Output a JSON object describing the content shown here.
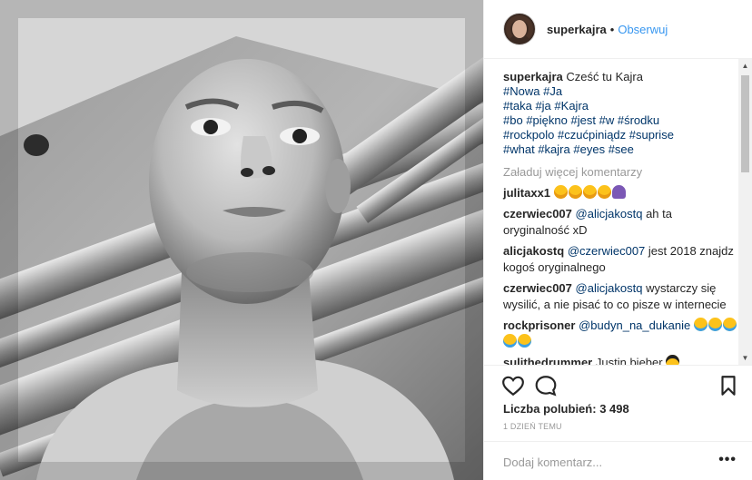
{
  "header": {
    "username": "superkajra",
    "separator": "•",
    "follow_label": "Obserwuj"
  },
  "caption": {
    "username": "superkajra",
    "text": "Cześć tu Kajra",
    "hashtag_lines": [
      [
        "#Nowa",
        "#Ja"
      ],
      [
        "#taka",
        "#ja",
        "#Kajra"
      ],
      [
        "#bo",
        "#piękno",
        "#jest",
        "#w",
        "#środku"
      ],
      [
        "#rockpolo",
        "#czućpiniądz",
        "#suprise"
      ],
      [
        "#what",
        "#kajra",
        "#eyes",
        "#see"
      ]
    ]
  },
  "load_more_label": "Załaduj więcej komentarzy",
  "comments": [
    {
      "user": "julitaxx1",
      "mention": "",
      "text": "",
      "emojis": [
        "scream",
        "scream",
        "scream",
        "scream",
        "person"
      ]
    },
    {
      "user": "czerwiec007",
      "mention": "@alicjakostq",
      "text": "ah ta oryginalność xD",
      "emojis": []
    },
    {
      "user": "alicjakostq",
      "mention": "@czerwiec007",
      "text": "jest 2018 znajdz kogoś oryginalnego",
      "emojis": []
    },
    {
      "user": "czerwiec007",
      "mention": "@alicjakostq",
      "text": "wystarczy się wysilić, a nie pisać to co pisze w internecie",
      "emojis": []
    },
    {
      "user": "rockprisoner",
      "mention": "@budyn_na_dukanie",
      "text": "",
      "emojis": [
        "laugh",
        "laugh",
        "laugh",
        "laugh",
        "laugh"
      ]
    },
    {
      "user": "sulithedrummer",
      "mention": "",
      "text": "Justin bieber",
      "emojis": [
        "cool"
      ]
    }
  ],
  "likes": {
    "label": "Liczba polubień:",
    "count": "3 498"
  },
  "timestamp": "1 DZIEŃ TEMU",
  "add_comment": {
    "placeholder": "Dodaj komentarz...",
    "options": "•••"
  },
  "icons": {
    "like": "heart-icon",
    "comment": "comment-bubble-icon",
    "save": "bookmark-icon"
  }
}
